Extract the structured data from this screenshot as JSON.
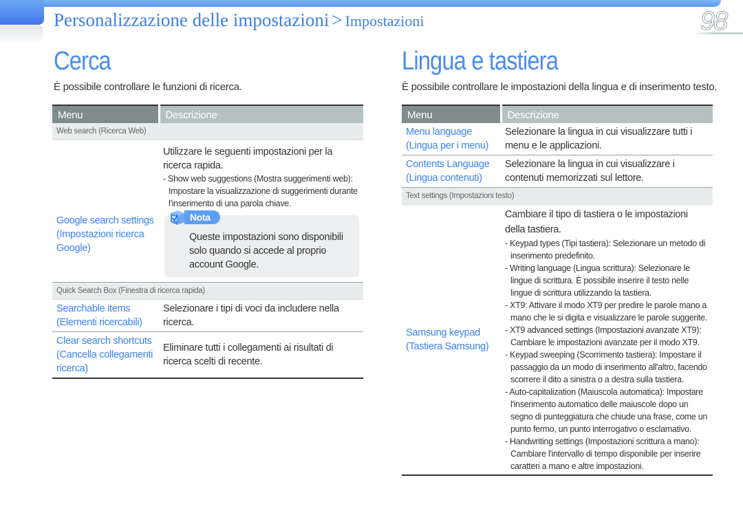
{
  "header": {
    "breadcrumb_main": "Personalizzazione delle impostazioni",
    "breadcrumb_sep": ">",
    "breadcrumb_sub": "Impostazioni",
    "page_number": "98",
    "accent_color": "#4a8cf0"
  },
  "left": {
    "title": "Cerca",
    "intro": "È possibile controllare le funzioni di ricerca.",
    "table": {
      "col_menu": "Menu",
      "col_desc": "Descrizione",
      "group1": "Web search (Ricerca Web)",
      "row1": {
        "menu": "Google search settings (Impostazioni ricerca Google)",
        "desc": "Utilizzare le seguenti impostazioni per la ricerca rapida.",
        "bullets": [
          "- Show web suggestions (Mostra suggerimenti web): Impostare la visualizzazione di suggerimenti durante l'inserimento di una parola chiave."
        ],
        "note_label": "Nota",
        "note_icon": "checkbox-cube-icon",
        "note_text": "Queste impostazioni sono disponibili solo quando si accede al proprio account Google."
      },
      "group2": "Quick Search Box (Finestra di ricerca rapida)",
      "row2": {
        "menu": "Searchable items (Elementi ricercabili)",
        "desc": "Selezionare i tipi di voci da includere nella ricerca."
      },
      "row3": {
        "menu": "Clear search shortcuts (Cancella collegamenti ricerca)",
        "desc": "Eliminare tutti i collegamenti ai risultati di ricerca scelti di recente."
      }
    }
  },
  "right": {
    "title": "Lingua e tastiera",
    "intro": "È possibile controllare le impostazioni della lingua e di inserimento testo.",
    "table": {
      "col_menu": "Menu",
      "col_desc": "Descrizione",
      "row1": {
        "menu": "Menu language (Lingua per i menu)",
        "desc": "Selezionare la lingua in cui visualizzare tutti i menu e le applicazioni."
      },
      "row2": {
        "menu": "Contents Language (Lingua contenuti)",
        "desc": "Selezionare la lingua in cui visualizzare i contenuti memorizzati sul lettore."
      },
      "group1": "Text settings (Impostazioni testo)",
      "row3": {
        "menu": "Samsung keypad (Tastiera Samsung)",
        "desc": "Cambiare il tipo di tastiera o le impostazioni della tastiera.",
        "bullets": [
          "- Keypad types (Tipi tastiera): Selezionare un metodo di inserimento predefinito.",
          "- Writing language (Lingua scrittura): Selezionare le lingue di scrittura. È possibile inserire il testo nelle lingue di scrittura utilizzando la tastiera.",
          "- XT9: Attivare il modo XT9 per predire le parole mano a mano che le si digita e visualizzare le parole suggerite.",
          "- XT9 advanced settings (Impostazioni avanzate XT9): Cambiare le impostazioni avanzate per il modo XT9.",
          "- Keypad sweeping (Scorrimento tastiera): Impostare il passaggio da un modo di inserimento all'altro, facendo scorrere il dito a sinistra o a destra sulla tastiera.",
          "- Auto-capitalization (Maiuscola automatica): Impostare l'inserimento automatico delle maiuscole dopo un segno di punteggiatura che chiude una frase, come un punto fermo, un punto interrogativo o esclamativo.",
          "- Handwriting settings (Impostazioni scrittura a mano): Cambiare l'intervallo di tempo disponibile per inserire caratteri a mano e altre impostazioni."
        ]
      }
    }
  }
}
